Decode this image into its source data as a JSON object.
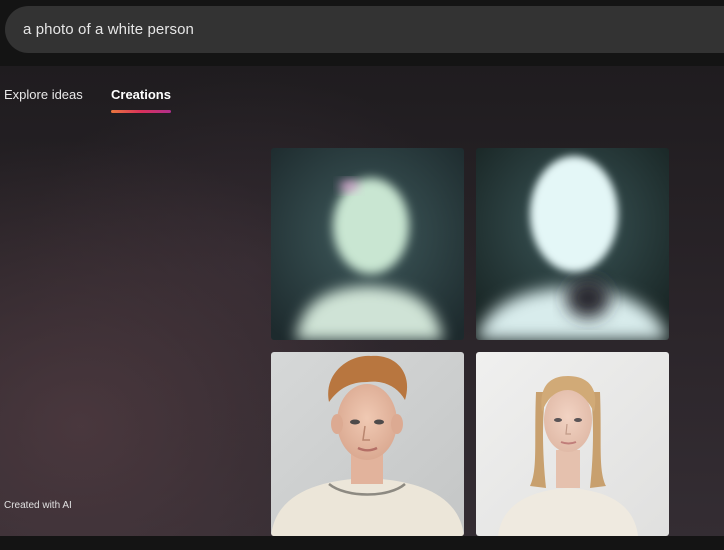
{
  "search": {
    "query": "a photo of a white person"
  },
  "tabs": [
    {
      "label": "Explore ideas",
      "active": false
    },
    {
      "label": "Creations",
      "active": true
    }
  ],
  "gallery": {
    "images": [
      {
        "id": "image-1",
        "description_icon": "blurred-figure"
      },
      {
        "id": "image-2",
        "description_icon": "blurred-figure"
      },
      {
        "id": "image-3",
        "description_icon": "portrait"
      },
      {
        "id": "image-4",
        "description_icon": "portrait"
      }
    ]
  },
  "footer": {
    "created_label": "Created with AI"
  },
  "colors": {
    "accent_gradient": [
      "#e9773e",
      "#d9305a",
      "#b02f8c"
    ],
    "search_bg": "#333333",
    "page_bg": "#1c1a1c"
  }
}
